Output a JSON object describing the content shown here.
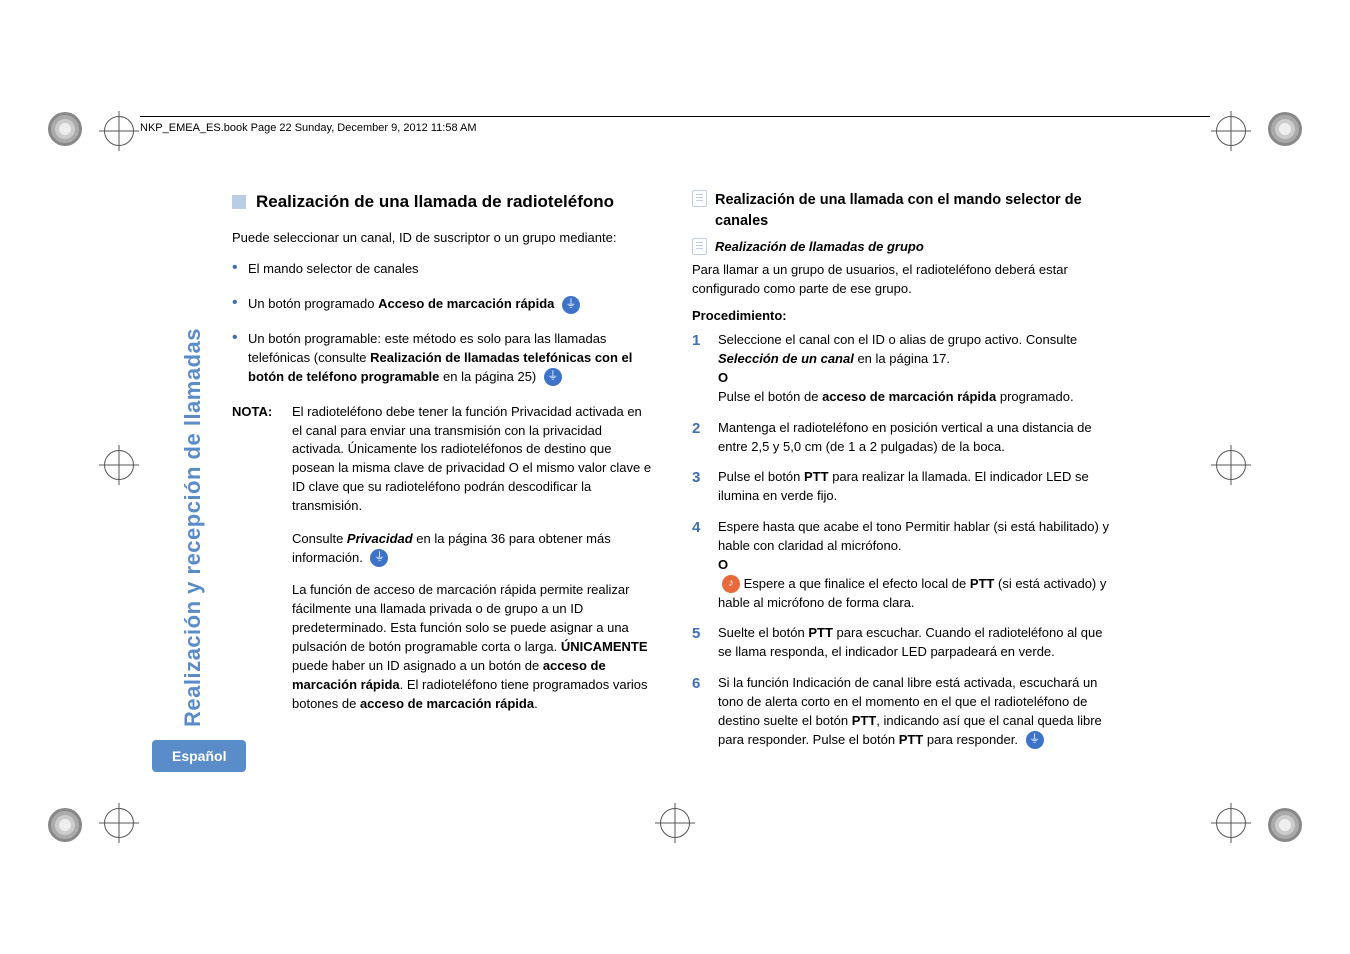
{
  "header": "NKP_EMEA_ES.book  Page 22  Sunday, December 9, 2012  11:58 AM",
  "sidebar": {
    "title": "Realización y recepción de llamadas",
    "page": "22",
    "lang": "Español"
  },
  "left": {
    "heading": "Realización de una llamada de radioteléfono",
    "intro": "Puede seleccionar un canal, ID de suscriptor o un grupo mediante:",
    "bullets": {
      "b1": "El mando selector de canales",
      "b2a": "Un botón programado ",
      "b2b": "Acceso de marcación rápida",
      "b3a": "Un botón programable",
      "b3b": ": este método es solo para las llamadas telefónicas (consulte ",
      "b3c": "Realización de llamadas telefónicas con el botón de teléfono programable",
      "b3d": " en la página 25)"
    },
    "note": {
      "label": "NOTA:",
      "p1": "El radioteléfono debe tener la función Privacidad activada en el canal para enviar una transmisión con la privacidad activada. Únicamente los radioteléfonos de destino que posean la misma clave de privacidad O el mismo valor clave e ID clave que su radioteléfono podrán descodificar la transmisión.",
      "p2a": "Consulte ",
      "p2b": "Privacidad",
      "p2c": " en la página 36 para obtener más información.",
      "p3a": "La función de acceso de marcación rápida permite realizar fácilmente una llamada privada o de grupo a un ID predeterminado. Esta función solo se puede asignar a una pulsación de botón programable corta o larga. ",
      "p3b": "ÚNICAMENTE",
      "p3c": " puede haber un ID asignado a un botón de ",
      "p3d": "acceso de marcación rápida",
      "p3e": ". El radioteléfono tiene programados varios botones de ",
      "p3f": "acceso de marcación rápida",
      "p3g": "."
    }
  },
  "right": {
    "heading": "Realización de una llamada con el mando selector de canales",
    "sub": "Realización de llamadas de grupo",
    "intro": "Para llamar a un grupo de usuarios, el radioteléfono deberá estar configurado como parte de ese grupo.",
    "procLabel": "Procedimiento:",
    "steps": {
      "s1a": "Seleccione el canal con el ID o alias de grupo activo. Consulte ",
      "s1b": "Selección de un canal",
      "s1c": " en la página 17.",
      "s1o": "O",
      "s1d": "Pulse el botón de ",
      "s1e": "acceso de marcación rápida",
      "s1f": " programado.",
      "s2": "Mantenga el radioteléfono en posición vertical a una distancia de entre 2,5 y 5,0 cm (de 1 a 2 pulgadas) de la boca.",
      "s3a": "Pulse el botón ",
      "s3b": "PTT",
      "s3c": " para realizar la llamada. El indicador LED se ilumina en verde fijo.",
      "s4a": "Espere hasta que acabe el tono Permitir hablar (si está habilitado) y hable con claridad al micrófono.",
      "s4o": "O",
      "s4b": " Espere a que finalice el efecto local de ",
      "s4c": "PTT",
      "s4d": " (si está activado) y hable al micrófono de forma clara.",
      "s5a": "Suelte el botón ",
      "s5b": "PTT",
      "s5c": " para escuchar. Cuando el radioteléfono al que se llama responda, el indicador LED parpadeará en verde.",
      "s6a": "Si la función Indicación de canal libre está activada, escuchará un tono de alerta corto en el momento en el que el radioteléfono de destino suelte el botón ",
      "s6b": "PTT",
      "s6c": ", indicando así que el canal queda libre para responder. Pulse el botón ",
      "s6d": "PTT",
      "s6e": " para responder."
    }
  }
}
